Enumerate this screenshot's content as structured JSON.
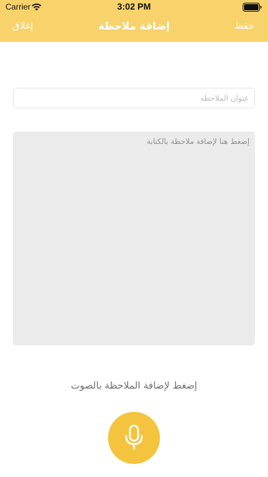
{
  "status_bar": {
    "carrier": "Carrier",
    "time": "3:02 PM",
    "wifi_icon": "wifi-icon",
    "battery_icon": "battery-icon"
  },
  "nav": {
    "close_label": "إغلاق",
    "title": "إضافة ملاحظة",
    "save_label": "حفظ"
  },
  "form": {
    "title_placeholder": "عنوان الملاحظة",
    "title_value": "",
    "body_placeholder": "إضغط هنا لإضافة ملاحظة بالكتابة",
    "body_value": ""
  },
  "voice": {
    "label": "إضغط لإضافة الملاحظة بالصوت",
    "icon": "microphone-icon"
  },
  "colors": {
    "header_bg": "#f8d26a",
    "mic_button_bg": "#f4c43e",
    "text_area_bg": "#ebebeb"
  }
}
